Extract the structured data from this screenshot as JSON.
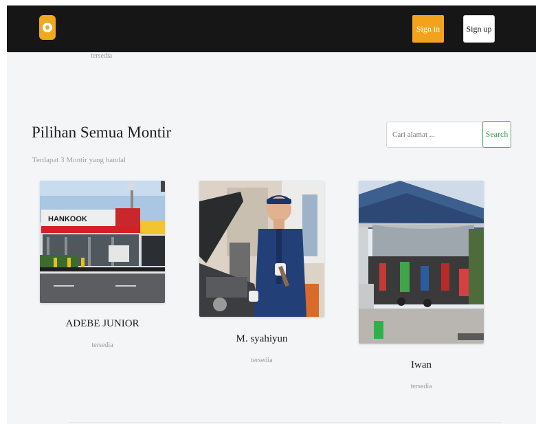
{
  "brand": {
    "logo_color": "#f0a91f"
  },
  "navbar": {
    "background": "#161616",
    "signin_label": "Sign in",
    "signup_label": "Sign up"
  },
  "ghost": {
    "status": "tersedia"
  },
  "section": {
    "title": "Pilihan Semua Montir",
    "subtitle": "Terdapat 3 Montir yang handal"
  },
  "search": {
    "placeholder": "Cari alamat ...",
    "button_label": "Search",
    "button_color": "#3a9a54"
  },
  "mechanics": [
    {
      "name": "ADEBE JUNIOR",
      "status": "tersedia",
      "image": "tire-shop-storefront",
      "shop_sign": "HANKOOK"
    },
    {
      "name": "M. syahiyun",
      "status": "tersedia",
      "image": "mechanic-with-wrench"
    },
    {
      "name": "Iwan",
      "status": "tersedia",
      "image": "motorcycle-workshop"
    }
  ]
}
